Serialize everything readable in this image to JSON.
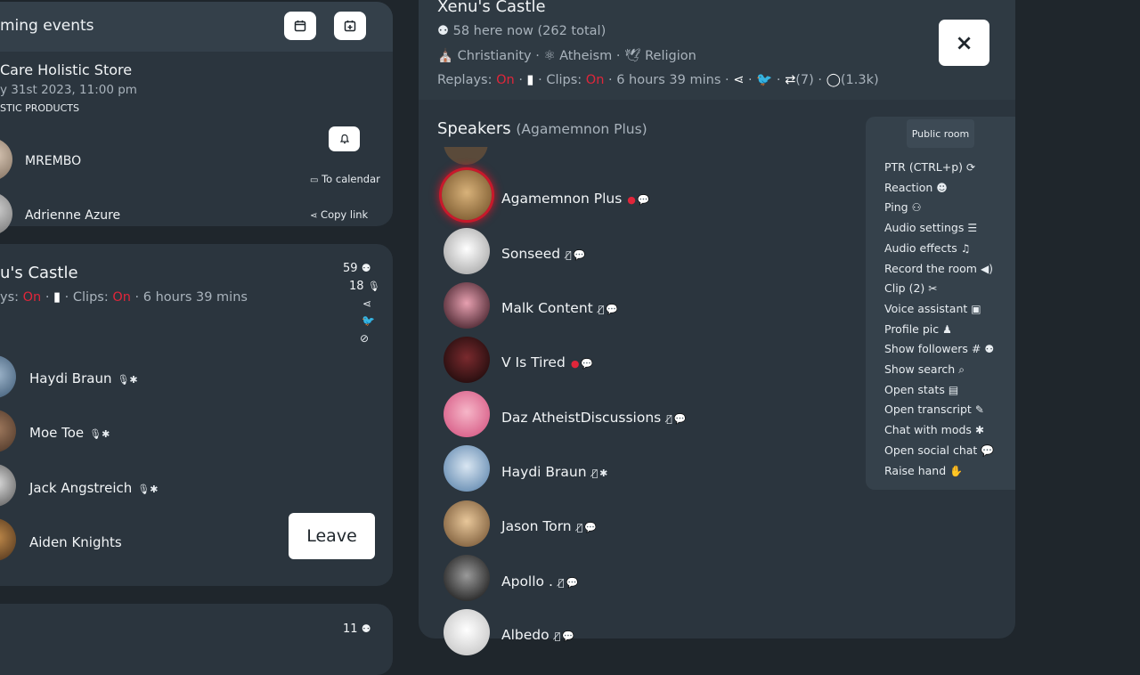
{
  "upcoming": {
    "title": "ming events",
    "event_title": "Care Holistic Store",
    "event_date": "y 31st 2023, 11:00 pm",
    "event_sub": "STIC PRODUCTS",
    "hosts": [
      "MREMBO",
      "Adrienne Azure"
    ],
    "to_calendar": "To calendar",
    "copy_link": "Copy link"
  },
  "left_room": {
    "title": "u's Castle",
    "replays_prefix": "ys:",
    "on1": "On",
    "clips": "Clips:",
    "on2": "On",
    "duration": "6 hours 39 mins",
    "listeners_count": "59",
    "speakers_count": "18",
    "speakers": [
      "Haydi Braun",
      "Moe Toe",
      "Jack Angstreich",
      "Aiden Knights"
    ],
    "leave_label": "Leave",
    "next_count": "11"
  },
  "room": {
    "title": "Xenu's Castle",
    "here_now": "58 here now (262 total)",
    "tags": [
      "Christianity",
      "Atheism",
      "Religion"
    ],
    "replays_label": "Replays:",
    "on1": "On",
    "clips_label": "Clips:",
    "on2": "On",
    "duration": "6 hours 39 mins",
    "retweets": "(7)",
    "comments": "(1.3k)",
    "speakers_heading": "Speakers",
    "speakers_owner": "(Agamemnon Plus)",
    "speakers": [
      {
        "name": "Agamemnon Plus",
        "color": "#b58a4e"
      },
      {
        "name": "Sonseed",
        "color": "#d8d8d8"
      },
      {
        "name": "Malk Content",
        "color": "#6b2535"
      },
      {
        "name": "V Is Tired",
        "color": "#3a1416"
      },
      {
        "name": "Daz AtheistDiscussions",
        "color": "#e8789a"
      },
      {
        "name": "Haydi Braun",
        "color": "#7da3c6"
      },
      {
        "name": "Jason Torn",
        "color": "#c9935a"
      },
      {
        "name": "Apollo .",
        "color": "#2a2a2a"
      },
      {
        "name": "Albedo",
        "color": "#e6e6e6"
      }
    ]
  },
  "side_menu": {
    "public_room": "Public room",
    "items": [
      {
        "label": "PTR (CTRL+p)",
        "icon": "refresh-icon",
        "glyph": "⟳"
      },
      {
        "label": "Reaction",
        "icon": "emoji-icon",
        "glyph": "☻"
      },
      {
        "label": "Ping",
        "icon": "user-plus-icon",
        "glyph": "⚇"
      },
      {
        "label": "Audio settings",
        "icon": "sliders-icon",
        "glyph": "☰"
      },
      {
        "label": "Audio effects",
        "icon": "music-icon",
        "glyph": "♫"
      },
      {
        "label": "Record the room",
        "icon": "speaker-icon",
        "glyph": "◀)"
      },
      {
        "label": "Clip (2)",
        "icon": "scissors-icon",
        "glyph": "✂"
      },
      {
        "label": "Voice assistant",
        "icon": "robot-icon",
        "glyph": "▣"
      },
      {
        "label": "Profile pic",
        "icon": "user-icon",
        "glyph": "♟"
      },
      {
        "label": "Show followers #",
        "icon": "users-icon",
        "glyph": "⚉"
      },
      {
        "label": "Show search",
        "icon": "search-icon",
        "glyph": "⌕"
      },
      {
        "label": "Open stats",
        "icon": "stats-icon",
        "glyph": "▤"
      },
      {
        "label": "Open transcript",
        "icon": "transcript-icon",
        "glyph": "✎"
      },
      {
        "label": "Chat with mods",
        "icon": "asterisk-icon",
        "glyph": "✱"
      },
      {
        "label": "Open social chat",
        "icon": "comments-icon",
        "glyph": "💬"
      },
      {
        "label": "Raise hand",
        "icon": "hand-icon",
        "glyph": "✋"
      }
    ]
  },
  "close_label": "×"
}
